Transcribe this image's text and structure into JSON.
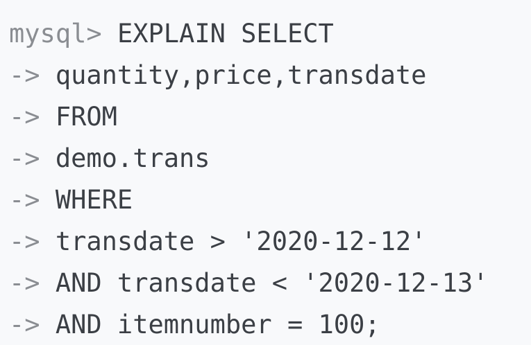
{
  "terminal": {
    "lines": [
      {
        "prompt": "mysql> ",
        "text": "EXPLAIN SELECT"
      },
      {
        "prompt": "-> ",
        "text": "quantity,price,transdate"
      },
      {
        "prompt": "-> ",
        "text": "FROM"
      },
      {
        "prompt": "-> ",
        "text": "demo.trans"
      },
      {
        "prompt": "-> ",
        "text": "WHERE"
      },
      {
        "prompt": "-> ",
        "text": "transdate > '2020-12-12'"
      },
      {
        "prompt": "-> ",
        "text": "AND transdate < '2020-12-13'"
      },
      {
        "prompt": "-> ",
        "text": "AND itemnumber = 100;"
      }
    ]
  },
  "colors": {
    "background": "#f8f9fb",
    "prompt": "#8a8d92",
    "text": "#3b3f45"
  }
}
